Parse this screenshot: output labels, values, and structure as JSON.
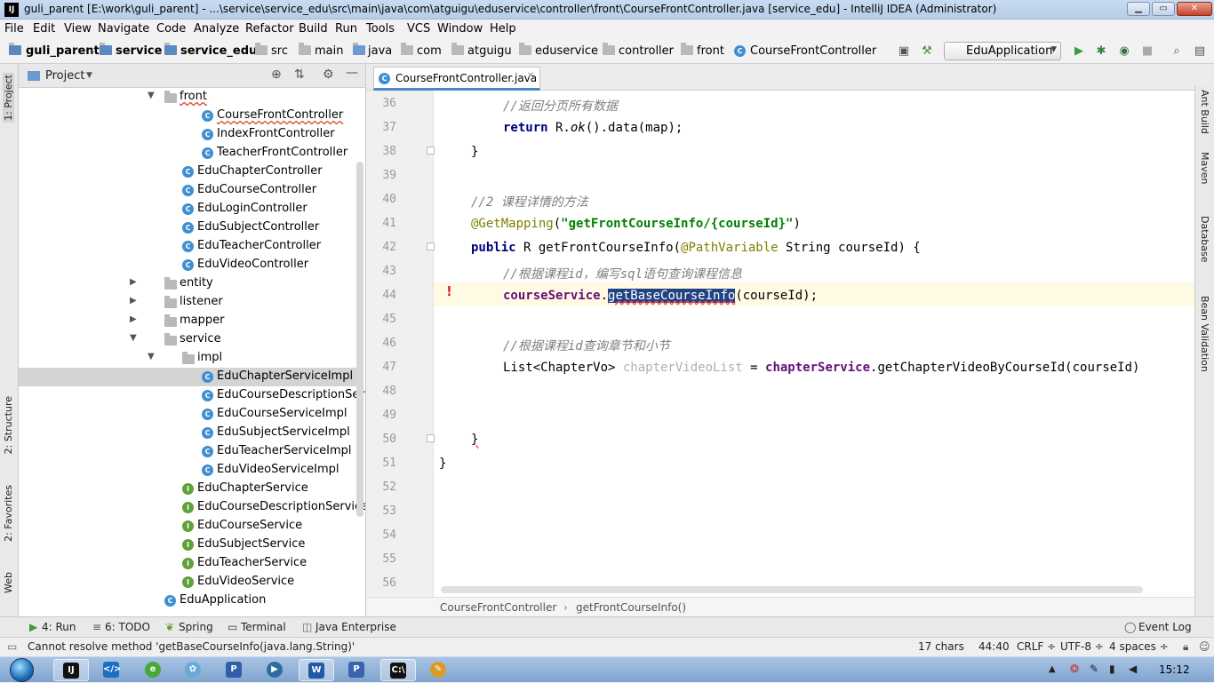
{
  "window": {
    "title": "guli_parent [E:\\work\\guli_parent] - ...\\service\\service_edu\\src\\main\\java\\com\\atguigu\\eduservice\\controller\\front\\CourseFrontController.java [service_edu] - IntelliJ IDEA (Administrator)"
  },
  "menu": [
    "File",
    "Edit",
    "View",
    "Navigate",
    "Code",
    "Analyze",
    "Refactor",
    "Build",
    "Run",
    "Tools",
    "VCS",
    "Window",
    "Help"
  ],
  "breadcrumbs": [
    "guli_parent",
    "service",
    "service_edu",
    "src",
    "main",
    "java",
    "com",
    "atguigu",
    "eduservice",
    "controller",
    "front",
    "CourseFrontController"
  ],
  "run_config": "EduApplication",
  "left_tabs": [
    "1: Project",
    "2: Structure",
    "2: Favorites",
    "Web"
  ],
  "project": {
    "title": "Project",
    "tree": [
      {
        "label": "front",
        "kind": "folder",
        "arrow": "down",
        "squiggle": true
      },
      {
        "label": "CourseFrontController",
        "kind": "class",
        "squiggle": true
      },
      {
        "label": "IndexFrontController",
        "kind": "class"
      },
      {
        "label": "TeacherFrontController",
        "kind": "class"
      },
      {
        "label": "EduChapterController",
        "kind": "class"
      },
      {
        "label": "EduCourseController",
        "kind": "class"
      },
      {
        "label": "EduLoginController",
        "kind": "class"
      },
      {
        "label": "EduSubjectController",
        "kind": "class"
      },
      {
        "label": "EduTeacherController",
        "kind": "class"
      },
      {
        "label": "EduVideoController",
        "kind": "class"
      },
      {
        "label": "entity",
        "kind": "folder",
        "arrow": "right"
      },
      {
        "label": "listener",
        "kind": "folder",
        "arrow": "right"
      },
      {
        "label": "mapper",
        "kind": "folder",
        "arrow": "right"
      },
      {
        "label": "service",
        "kind": "folder",
        "arrow": "down"
      },
      {
        "label": "impl",
        "kind": "folder",
        "arrow": "down"
      },
      {
        "label": "EduChapterServiceImpl",
        "kind": "class",
        "selected": true
      },
      {
        "label": "EduCourseDescriptionService",
        "kind": "class"
      },
      {
        "label": "EduCourseServiceImpl",
        "kind": "class"
      },
      {
        "label": "EduSubjectServiceImpl",
        "kind": "class"
      },
      {
        "label": "EduTeacherServiceImpl",
        "kind": "class"
      },
      {
        "label": "EduVideoServiceImpl",
        "kind": "class"
      },
      {
        "label": "EduChapterService",
        "kind": "interface"
      },
      {
        "label": "EduCourseDescriptionService",
        "kind": "interface"
      },
      {
        "label": "EduCourseService",
        "kind": "interface"
      },
      {
        "label": "EduSubjectService",
        "kind": "interface"
      },
      {
        "label": "EduTeacherService",
        "kind": "interface"
      },
      {
        "label": "EduVideoService",
        "kind": "interface"
      },
      {
        "label": "EduApplication",
        "kind": "app"
      }
    ]
  },
  "editor": {
    "tab": "CourseFrontController.java",
    "line_numbers": [
      "36",
      "37",
      "38",
      "39",
      "40",
      "41",
      "42",
      "43",
      "44",
      "45",
      "46",
      "47",
      "48",
      "49",
      "50",
      "51",
      "52",
      "53",
      "54",
      "55",
      "56"
    ],
    "code": {
      "l36": "//返回分页所有数据",
      "l37_kw": "return",
      "l37_rest": " R.",
      "l37_ok": "ok",
      "l37_end": "().data(map);",
      "l38": "}",
      "l40": "//2 课程详情的方法",
      "l41_ann": "@GetMapping",
      "l41_open": "(",
      "l41_str": "\"getFrontCourseInfo/{courseId}\"",
      "l41_close": ")",
      "l42_kw": "public",
      "l42_mid": " R getFrontCourseInfo(",
      "l42_ann": "@PathVariable",
      "l42_end": " String courseId) {",
      "l43": "//根据课程id，编写sql语句查询课程信息",
      "l44_fld": "courseService",
      "l44_dot": ".",
      "l44_sel": "getBaseCourseInfo",
      "l44_end": "(courseId);",
      "l46": "//根据课程id查询章节和小节",
      "l47_type": "List<ChapterVo> ",
      "l47_var": "chapterVideoList",
      "l47_eq": " = ",
      "l47_fld": "chapterService",
      "l47_end": ".getChapterVideoByCourseId(courseId)",
      "l50": "}",
      "l51": "}"
    },
    "crumbs": [
      "CourseFrontController",
      "getFrontCourseInfo()"
    ]
  },
  "right_tabs": [
    "Ant Build",
    "Maven",
    "Database",
    "Bean Validation"
  ],
  "bottom_tabs": [
    "4: Run",
    "6: TODO",
    "Spring",
    "Terminal",
    "Java Enterprise",
    "Event Log"
  ],
  "status": {
    "message": "Cannot resolve method 'getBaseCourseInfo(java.lang.String)'",
    "chars": "17 chars",
    "position": "44:40",
    "line_sep": "CRLF ÷",
    "encoding": "UTF-8 ÷",
    "indent": "4 spaces ÷"
  },
  "taskbar": {
    "time": "15:12"
  },
  "colors": {
    "selection": "#214283",
    "current_line": "#fffae3",
    "error": "#d42f2f",
    "class_icon": "#3f8fd2",
    "interface_icon": "#5fa13a"
  }
}
